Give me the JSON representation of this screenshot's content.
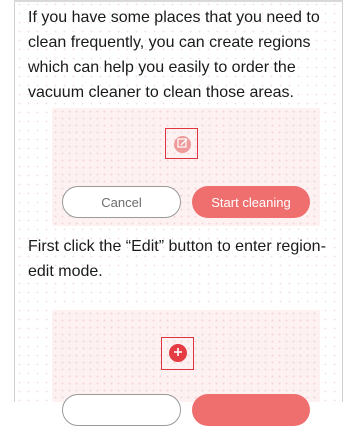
{
  "paragraphs": {
    "intro": "If you have some places that you need to clean frequently, you can create regions which can help you easily to order the vacuum cleaner to clean those areas.",
    "step1": "First click the “Edit” button to enter region-edit mode."
  },
  "screenshot1": {
    "edit_icon": "edit-icon",
    "cancel_label": "Cancel",
    "start_label": "Start cleaning"
  },
  "screenshot2": {
    "add_icon": "plus-icon",
    "cancel_label": "",
    "start_label": ""
  },
  "colors": {
    "accent": "#ef6f6f",
    "highlight": "#e0353d",
    "panel_bg": "#fdf1f1"
  }
}
